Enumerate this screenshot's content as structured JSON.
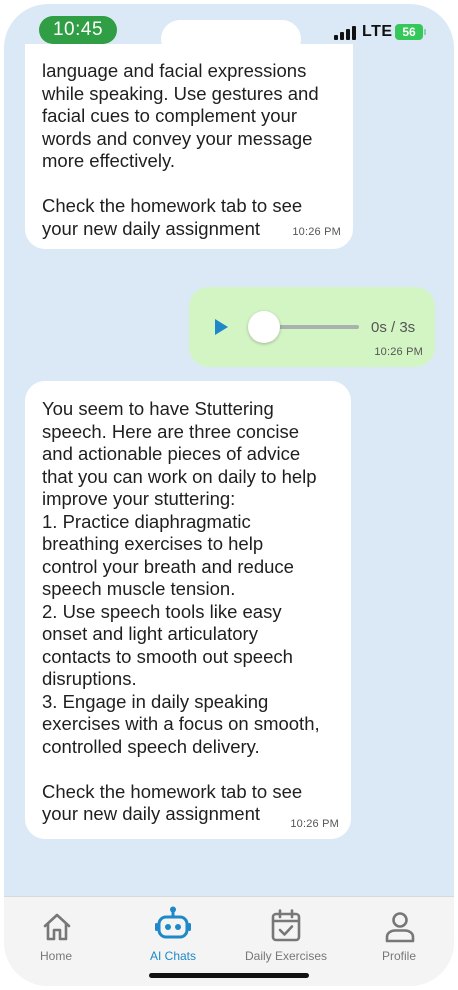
{
  "status_bar": {
    "time": "10:45",
    "network": "LTE",
    "battery": "56"
  },
  "messages": [
    {
      "sender": "bot",
      "text": "language and facial expressions\nwhile speaking. Use gestures and\nfacial cues to complement your\nwords and convey your message\nmore effectively.\n\nCheck the homework tab to see\nyour new daily assignment",
      "time": "10:26 PM"
    },
    {
      "sender": "user",
      "type": "audio",
      "progress": 0,
      "duration": "0s / 3s",
      "time": "10:26 PM"
    },
    {
      "sender": "bot",
      "text": "You seem to have Stuttering\nspeech. Here are three concise\nand actionable pieces of advice\nthat you can work on daily to help\nimprove your stuttering:\n1. Practice diaphragmatic\nbreathing exercises to help\ncontrol your breath and reduce\nspeech muscle tension.\n2. Use speech tools like easy\nonset and light articulatory\ncontacts to smooth out speech\ndisruptions.\n3. Engage in daily speaking\nexercises with a focus on smooth,\ncontrolled speech delivery.\n\nCheck the homework tab to see\nyour new daily assignment",
      "time": "10:26 PM"
    }
  ],
  "tabs": [
    {
      "label": "Home",
      "icon": "home-icon",
      "active": false
    },
    {
      "label": "AI Chats",
      "icon": "robot-icon",
      "active": true
    },
    {
      "label": "Daily Exercises",
      "icon": "calendar-check-icon",
      "active": false
    },
    {
      "label": "Profile",
      "icon": "person-icon",
      "active": false
    }
  ],
  "colors": {
    "accent": "#1e88c9",
    "chat_background": "#dbe9f6",
    "user_bubble": "#d3f5c4",
    "bot_bubble": "#ffffff",
    "time_pill": "#2f9e44",
    "battery": "#34c759"
  }
}
